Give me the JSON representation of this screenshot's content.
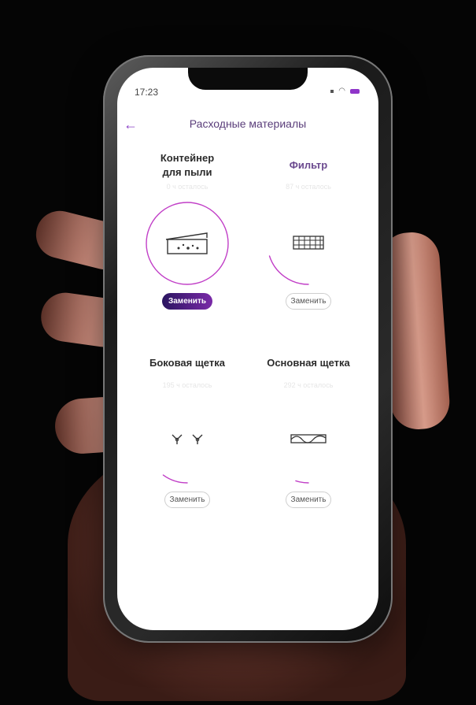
{
  "status_bar": {
    "time": "17:23"
  },
  "header": {
    "title": "Расходные материалы"
  },
  "colors": {
    "accent": "#c13fc7",
    "button_dark": "#2a1560",
    "title": "#5a3d7a"
  },
  "items": [
    {
      "name": "Контейнер\nдля пыли",
      "remaining": "0 ч осталось",
      "progress": 1.0,
      "icon": "dust-container-icon",
      "button": "Заменить",
      "primary": true
    },
    {
      "name": "Фильтр",
      "remaining": "87 ч осталось",
      "progress": 0.2,
      "icon": "filter-icon",
      "button": "Заменить",
      "primary": false
    },
    {
      "name": "Боковая щетка",
      "remaining": "195 ч осталось",
      "progress": 0.1,
      "icon": "side-brush-icon",
      "button": "Заменить",
      "primary": false
    },
    {
      "name": "Основная щетка",
      "remaining": "292 ч осталось",
      "progress": 0.05,
      "icon": "main-brush-icon",
      "button": "Заменить",
      "primary": false
    }
  ]
}
